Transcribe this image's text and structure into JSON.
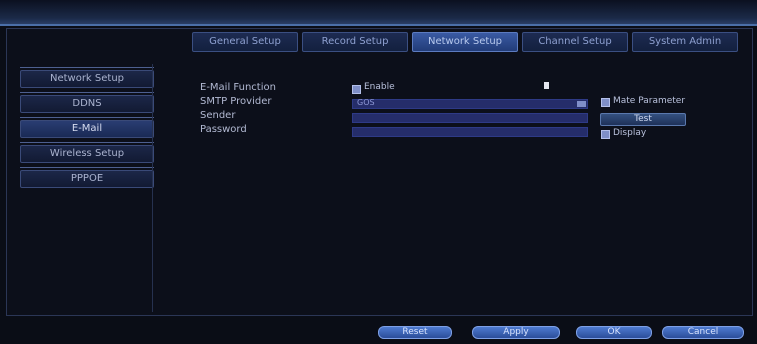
{
  "tabs": [
    {
      "label": "General Setup",
      "active": false
    },
    {
      "label": "Record Setup",
      "active": false
    },
    {
      "label": "Network Setup",
      "active": true
    },
    {
      "label": "Channel Setup",
      "active": false
    },
    {
      "label": "System Admin",
      "active": false
    }
  ],
  "sidebar": {
    "items": [
      {
        "label": "Network Setup"
      },
      {
        "label": "DDNS"
      },
      {
        "label": "E-Mail"
      },
      {
        "label": "Wireless Setup"
      },
      {
        "label": "PPPOE"
      }
    ]
  },
  "form": {
    "email_function_label": "E-Mail Function",
    "enable_label": "Enable",
    "smtp_provider_label": "SMTP Provider",
    "smtp_provider_value": "GOS",
    "mate_parameter_label": "Mate Parameter",
    "sender_label": "Sender",
    "sender_value": "",
    "test_label": "Test",
    "password_label": "Password",
    "password_value": "",
    "display_label": "Display"
  },
  "footer": {
    "reset_label": "Reset",
    "apply_label": "Apply",
    "ok_label": "OK",
    "cancel_label": "Cancel"
  },
  "colors": {
    "background": "#0a0d16",
    "active_tab": "#3a5aa3",
    "button": "#3d68bd"
  }
}
